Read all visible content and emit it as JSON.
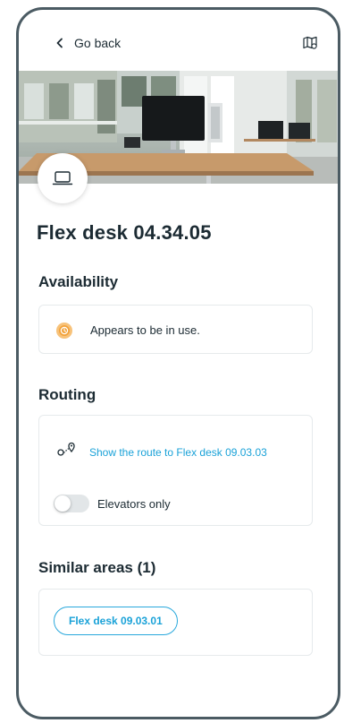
{
  "header": {
    "back_label": "Go back",
    "back_icon": "chevron-left-icon",
    "map_icon": "map-icon"
  },
  "space": {
    "title": "Flex desk 04.34.05",
    "type_icon": "laptop-icon"
  },
  "availability": {
    "heading": "Availability",
    "status_text": "Appears to be in use.",
    "status_color": "#f2a23a"
  },
  "routing": {
    "heading": "Routing",
    "route_link": "Show the route to Flex desk 09.03.03",
    "elevators_label": "Elevators only",
    "elevators_only": false
  },
  "similar": {
    "heading": "Similar areas (1)",
    "items": [
      "Flex desk 09.03.01"
    ]
  },
  "colors": {
    "accent": "#1aa2d8",
    "frame": "#4b5b63",
    "text": "#1c2b33"
  }
}
